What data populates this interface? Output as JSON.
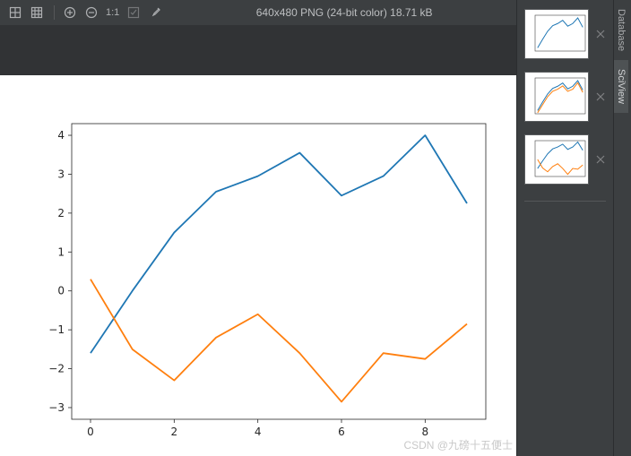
{
  "toolbar": {
    "title": "640x480 PNG (24-bit color) 18.71 kB",
    "one_to_one": "1:1",
    "icons": {
      "grid_single": "grid-icon",
      "grid_multi": "grid-4-icon",
      "zoom_in": "zoom-in-icon",
      "zoom_out": "zoom-out-icon",
      "fit": "fit-icon",
      "picker": "color-picker-icon"
    }
  },
  "side_tabs": {
    "database": "Database",
    "sciview": "SciView"
  },
  "watermark": "CSDN @九磅十五便士",
  "chart_data": {
    "main": {
      "type": "line",
      "x": [
        0,
        1,
        2,
        3,
        4,
        5,
        6,
        7,
        8,
        9
      ],
      "series": [
        {
          "name": "blue",
          "color": "#1f77b4",
          "values": [
            -1.6,
            0.0,
            1.5,
            2.55,
            2.95,
            3.55,
            2.45,
            2.95,
            4.0,
            2.25
          ]
        },
        {
          "name": "orange",
          "color": "#ff7f0e",
          "values": [
            0.3,
            -1.5,
            -2.3,
            -1.2,
            -0.6,
            -1.6,
            -2.85,
            -1.6,
            -1.75,
            -0.85
          ]
        }
      ],
      "xticks": [
        0,
        2,
        4,
        6,
        8
      ],
      "yticks": [
        -3,
        -2,
        -1,
        0,
        1,
        2,
        3,
        4
      ],
      "xlim": [
        -0.45,
        9.45
      ],
      "ylim": [
        -3.3,
        4.3
      ]
    },
    "thumbs": [
      {
        "type": "line",
        "x": [
          0,
          1,
          2,
          3,
          4,
          5,
          6,
          7,
          8,
          9
        ],
        "series": [
          {
            "color": "#1f77b4",
            "values": [
              -1.6,
              0,
              1.5,
              2.55,
              2.95,
              3.55,
              2.45,
              2.95,
              4.0,
              2.25
            ]
          }
        ],
        "xlim": [
          -0.5,
          9.5
        ],
        "ylim": [
          -2.2,
          4.5
        ]
      },
      {
        "type": "line",
        "x": [
          0,
          1,
          2,
          3,
          4,
          5,
          6,
          7,
          8,
          9
        ],
        "series": [
          {
            "color": "#1f77b4",
            "values": [
              -1.6,
              0,
              1.5,
              2.55,
              2.95,
              3.55,
              2.45,
              2.95,
              4.0,
              2.25
            ]
          },
          {
            "color": "#ff7f0e",
            "values": [
              -2.0,
              -0.5,
              1.0,
              2.0,
              2.4,
              3.0,
              2.0,
              2.4,
              3.6,
              1.8
            ]
          }
        ],
        "xlim": [
          -0.5,
          9.5
        ],
        "ylim": [
          -2.2,
          4.5
        ]
      },
      {
        "type": "line",
        "x": [
          0,
          1,
          2,
          3,
          4,
          5,
          6,
          7,
          8,
          9
        ],
        "series": [
          {
            "color": "#1f77b4",
            "values": [
              -1.6,
              0,
              1.5,
              2.55,
              2.95,
              3.55,
              2.45,
              2.95,
              4.0,
              2.25
            ]
          },
          {
            "color": "#ff7f0e",
            "values": [
              0.3,
              -1.5,
              -2.3,
              -1.2,
              -0.6,
              -1.6,
              -2.85,
              -1.6,
              -1.75,
              -0.85
            ]
          }
        ],
        "xlim": [
          -0.5,
          9.5
        ],
        "ylim": [
          -3.3,
          4.3
        ]
      }
    ]
  }
}
